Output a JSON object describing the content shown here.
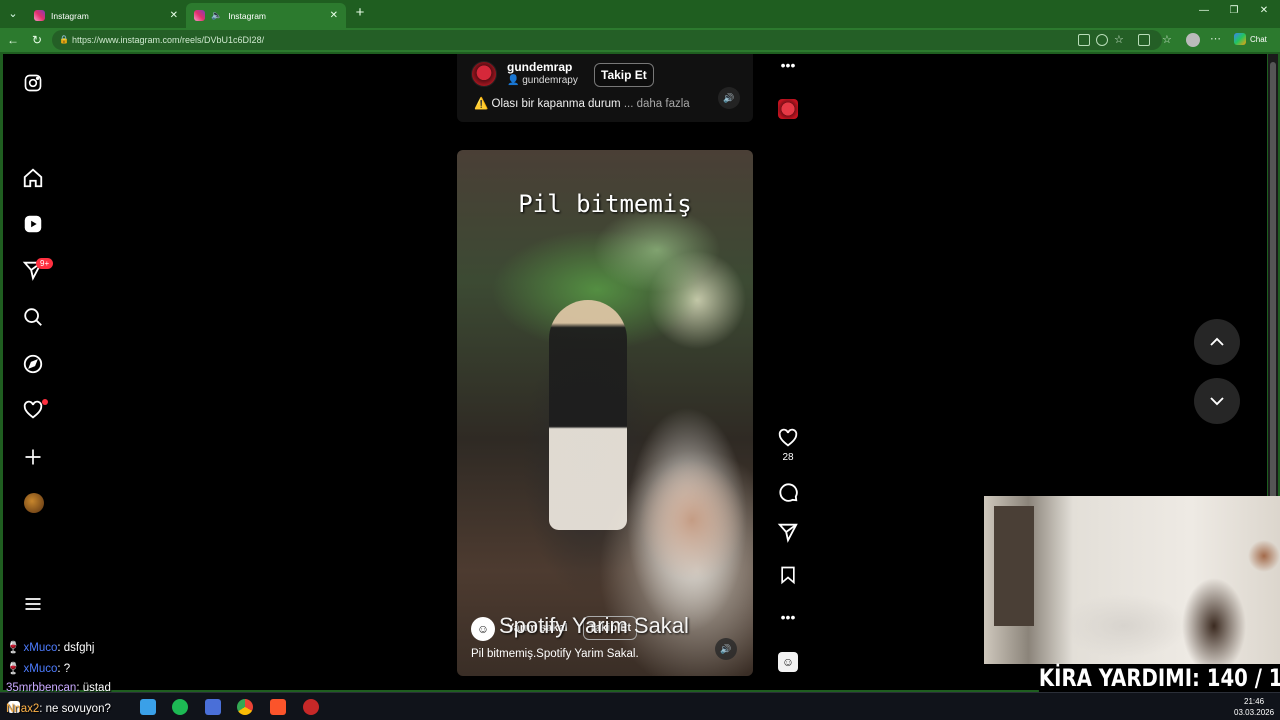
{
  "browser": {
    "tabs": [
      {
        "label": "Instagram"
      },
      {
        "label": "Instagram"
      }
    ],
    "url": "https://www.instagram.com/reels/DVbU1c6DI28/",
    "chat_label": "Chat"
  },
  "sidebar": {
    "notifications_badge": "9+",
    "items": [
      "instagram-logo",
      "home",
      "reels",
      "direct-messages",
      "search",
      "explore",
      "notifications",
      "create",
      "profile",
      "more"
    ]
  },
  "top_reel": {
    "username": "gundemrap",
    "sub_username": "gundemrapy",
    "follow_label": "Takip Et",
    "caption": "⚠️ Olası bir kapanma durum",
    "more_label": "... daha fazla"
  },
  "reel": {
    "overlay_text": "Pil bitmemiş",
    "username": "Yarım sakal",
    "follow_label": "Takip Et",
    "watermark_text": "Spotify Yarim Sakal",
    "caption": "Pil bitmemiş.Spotify Yarim Sakal.",
    "likes": "28"
  },
  "stream_overlay": {
    "banner": "KİRA YARDIMI:  140 / 145",
    "chat": [
      {
        "user": "xMuco",
        "message": ": dsfghj"
      },
      {
        "user": "xMuco",
        "message": ": ?"
      },
      {
        "user": "35mrbbencan",
        "message": ": üstad"
      },
      {
        "user": "Nnax2",
        "message": ": ne sovuyon?"
      }
    ]
  },
  "taskbar": {
    "time": "21:46",
    "date": "03.03.2026"
  },
  "colors": {
    "browser_green": "#1f5e20",
    "instagram_bg": "#000000",
    "notification_red": "#ff3040"
  }
}
